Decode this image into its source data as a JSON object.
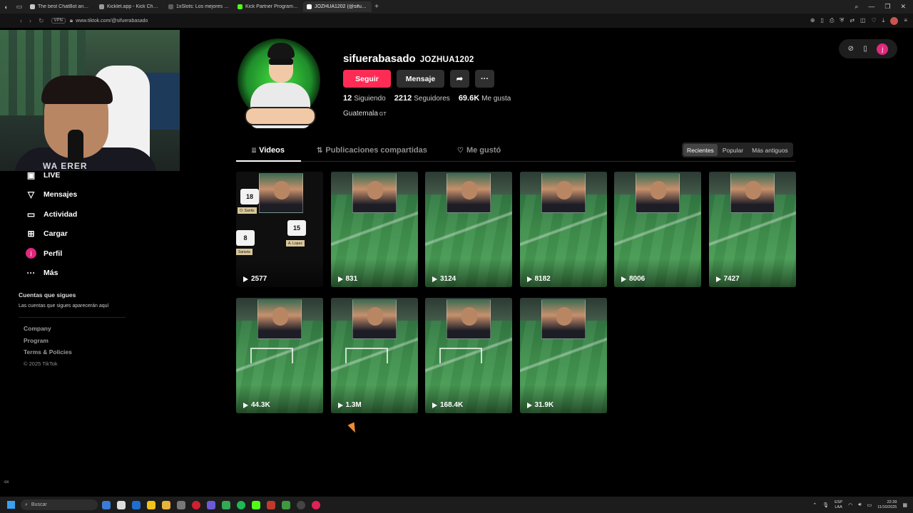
{
  "browser": {
    "tabs": [
      {
        "label": "The best ChatBot and Wi",
        "color": "#c7c7c7"
      },
      {
        "label": "Kicklet.app - Kick Chatbo",
        "color": "#9a9a9a"
      },
      {
        "label": "1xSlots: Los mejores cas",
        "color": "#5d5d5d"
      },
      {
        "label": "Kick Partner Program - K",
        "color": "#53fc18"
      },
      {
        "label": "JOZHUA1202 (@sifuerab",
        "color": "#ffffff"
      }
    ],
    "vpn_label": "VPN",
    "url": "www.tiktok.com/@sifuerabasado"
  },
  "profile": {
    "username": "sifuerabasado",
    "nickname": "JOZHUA1202",
    "follow_label": "Seguir",
    "message_label": "Mensaje",
    "share_icon": "share-icon",
    "more_label": "···",
    "following_count": "12",
    "following_label": "Siguiendo",
    "followers_count": "2212",
    "followers_label": "Seguidores",
    "likes_count": "69.6K",
    "likes_label": "Me gusta",
    "country": "Guatemala",
    "country_code": "GT"
  },
  "tabs": {
    "videos": "Videos",
    "reposts": "Publicaciones compartidas",
    "liked": "Me gustó"
  },
  "sort": {
    "recent": "Recientes",
    "popular": "Popular",
    "oldest": "Más antiguos"
  },
  "videos": [
    {
      "views": "2577"
    },
    {
      "views": "831"
    },
    {
      "views": "3124"
    },
    {
      "views": "8182"
    },
    {
      "views": "8006"
    },
    {
      "views": "7427"
    },
    {
      "views": "44.3K"
    },
    {
      "views": "1.3M"
    },
    {
      "views": "168.4K"
    },
    {
      "views": "31.9K"
    }
  ],
  "lineup": {
    "player1_number": "18",
    "player1_name": "O. Santis",
    "player2_number": "15",
    "player2_name": "A. Lopez",
    "player3_number": "8",
    "player3_name": "Saravia"
  },
  "webcam_overlay": {
    "text": "WA ERER"
  },
  "sidebar": {
    "items": [
      {
        "label": "LIVE",
        "icon": "live-icon"
      },
      {
        "label": "Mensajes",
        "icon": "send-icon"
      },
      {
        "label": "Actividad",
        "icon": "activity-icon"
      },
      {
        "label": "Cargar",
        "icon": "upload-icon"
      },
      {
        "label": "Perfil",
        "icon": "profile-icon"
      },
      {
        "label": "Más",
        "icon": "more-icon"
      }
    ],
    "profile_initial": "j",
    "following_title": "Cuentas que sigues",
    "following_sub": "Las cuentas que sigues aparecerán aquí",
    "footer": [
      "Company",
      "Program",
      "Terms & Policies"
    ],
    "copyright": "© 2025 TikTok",
    "bottom_small": "ox"
  },
  "float_pill": {
    "avatar_initial": "j"
  },
  "taskbar": {
    "search_placeholder": "Buscar",
    "lang_top": "ESP",
    "lang_bottom": "LAA",
    "time": "22:39",
    "date": "11/10/2025"
  }
}
